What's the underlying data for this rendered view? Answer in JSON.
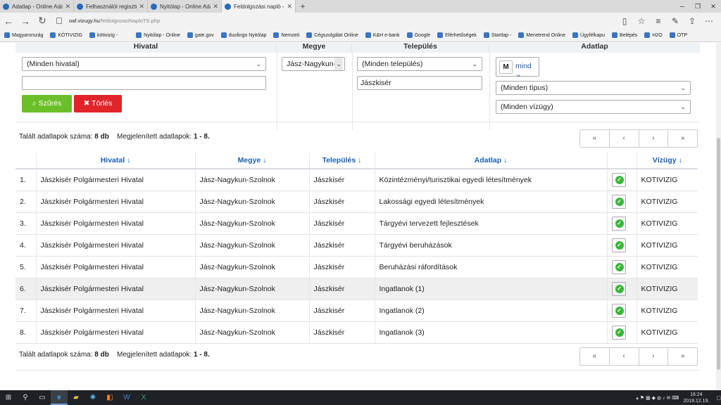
{
  "browser": {
    "tabs": [
      {
        "label": "Adatlap - Online Adatfeldol"
      },
      {
        "label": "Felhasználói regisztrációs o"
      },
      {
        "label": "Nyitólap - Online Adatfeldo"
      },
      {
        "label": "Feldolgozási napló - Onl"
      }
    ],
    "url_domain": "oaf.vizugy.hu",
    "url_path": "/feldolgozasiNaploTS.php",
    "bookmarks": [
      "Magyarország",
      "KÖTIVIZIG",
      "kötivizig -",
      "Nyitólap - Online",
      "gate.gov",
      "duolingo Nyitólap",
      "Nemzeti",
      "Cégszolgálat Online",
      "K&H e-bank",
      "Google",
      "Elérhetőségek",
      "Startlap -",
      "Menetrend Online",
      "Ügyfélkapu",
      "Belépés",
      "H2O",
      "OTP"
    ]
  },
  "filters": {
    "headers": {
      "hivatal": "Hivatal",
      "megye": "Megye",
      "telepules": "Település",
      "adatlap": "Adatlap"
    },
    "hivatal_select": "(Minden hivatal)",
    "hivatal_text": "",
    "megye_select": "Jász-Nagykun-S",
    "telepules_select": "(Minden település)",
    "telepules_text": "Jászkisér",
    "m_label": "M",
    "mind_label": "mind",
    "tipus_select": "(Minden típus)",
    "vizugy_select": "(Minden vízügy)",
    "filter_button": "Szűrés",
    "clear_button": "Törlés"
  },
  "results": {
    "found_label": "Talált adatlapok száma:",
    "found_count": "8 db",
    "shown_label": "Megjelenített adatlapok:",
    "shown_range": "1 - 8."
  },
  "pager": {
    "first": "«",
    "prev": "‹",
    "next": "›",
    "last": "»"
  },
  "table": {
    "columns": [
      "Hivatal",
      "Megye",
      "Település",
      "Adatlap",
      "Vízügy"
    ],
    "rows": [
      {
        "n": "1.",
        "hivatal": "Jászkisér Polgármesteri Hivatal",
        "megye": "Jász-Nagykun-Szolnok",
        "telepules": "Jászkisér",
        "adatlap": "Közintézményi/turisztikai egyedi létesítmények",
        "vizugy": "KOTIVIZIG"
      },
      {
        "n": "2.",
        "hivatal": "Jászkisér Polgármesteri Hivatal",
        "megye": "Jász-Nagykun-Szolnok",
        "telepules": "Jászkisér",
        "adatlap": "Lakossági egyedi létesítmények",
        "vizugy": "KOTIVIZIG"
      },
      {
        "n": "3.",
        "hivatal": "Jászkisér Polgármesteri Hivatal",
        "megye": "Jász-Nagykun-Szolnok",
        "telepules": "Jászkisér",
        "adatlap": "Tárgyévi tervezett fejlesztések",
        "vizugy": "KOTIVIZIG"
      },
      {
        "n": "4.",
        "hivatal": "Jászkisér Polgármesteri Hivatal",
        "megye": "Jász-Nagykun-Szolnok",
        "telepules": "Jászkisér",
        "adatlap": "Tárgyévi beruházások",
        "vizugy": "KOTIVIZIG"
      },
      {
        "n": "5.",
        "hivatal": "Jászkisér Polgármesteri Hivatal",
        "megye": "Jász-Nagykun-Szolnok",
        "telepules": "Jászkisér",
        "adatlap": "Beruházási ráfordítások",
        "vizugy": "KOTIVIZIG"
      },
      {
        "n": "6.",
        "hivatal": "Jászkisér Polgármesteri Hivatal",
        "megye": "Jász-Nagykun-Szolnok",
        "telepules": "Jászkisér",
        "adatlap": "Ingatlanok (1)",
        "vizugy": "KOTIVIZIG"
      },
      {
        "n": "7.",
        "hivatal": "Jászkisér Polgármesteri Hivatal",
        "megye": "Jász-Nagykun-Szolnok",
        "telepules": "Jászkisér",
        "adatlap": "Ingatlanok (2)",
        "vizugy": "KOTIVIZIG"
      },
      {
        "n": "8.",
        "hivatal": "Jászkisér Polgármesteri Hivatal",
        "megye": "Jász-Nagykun-Szolnok",
        "telepules": "Jászkisér",
        "adatlap": "Ingatlanok (3)",
        "vizugy": "KOTIVIZIG"
      }
    ]
  },
  "taskbar": {
    "time": "16:24",
    "date": "2018.12.19."
  },
  "colors": {
    "accent": "#1b5fb0",
    "filter_button": "#6cbf2a",
    "clear_button": "#e0242a",
    "status_ok": "#3db53d"
  }
}
